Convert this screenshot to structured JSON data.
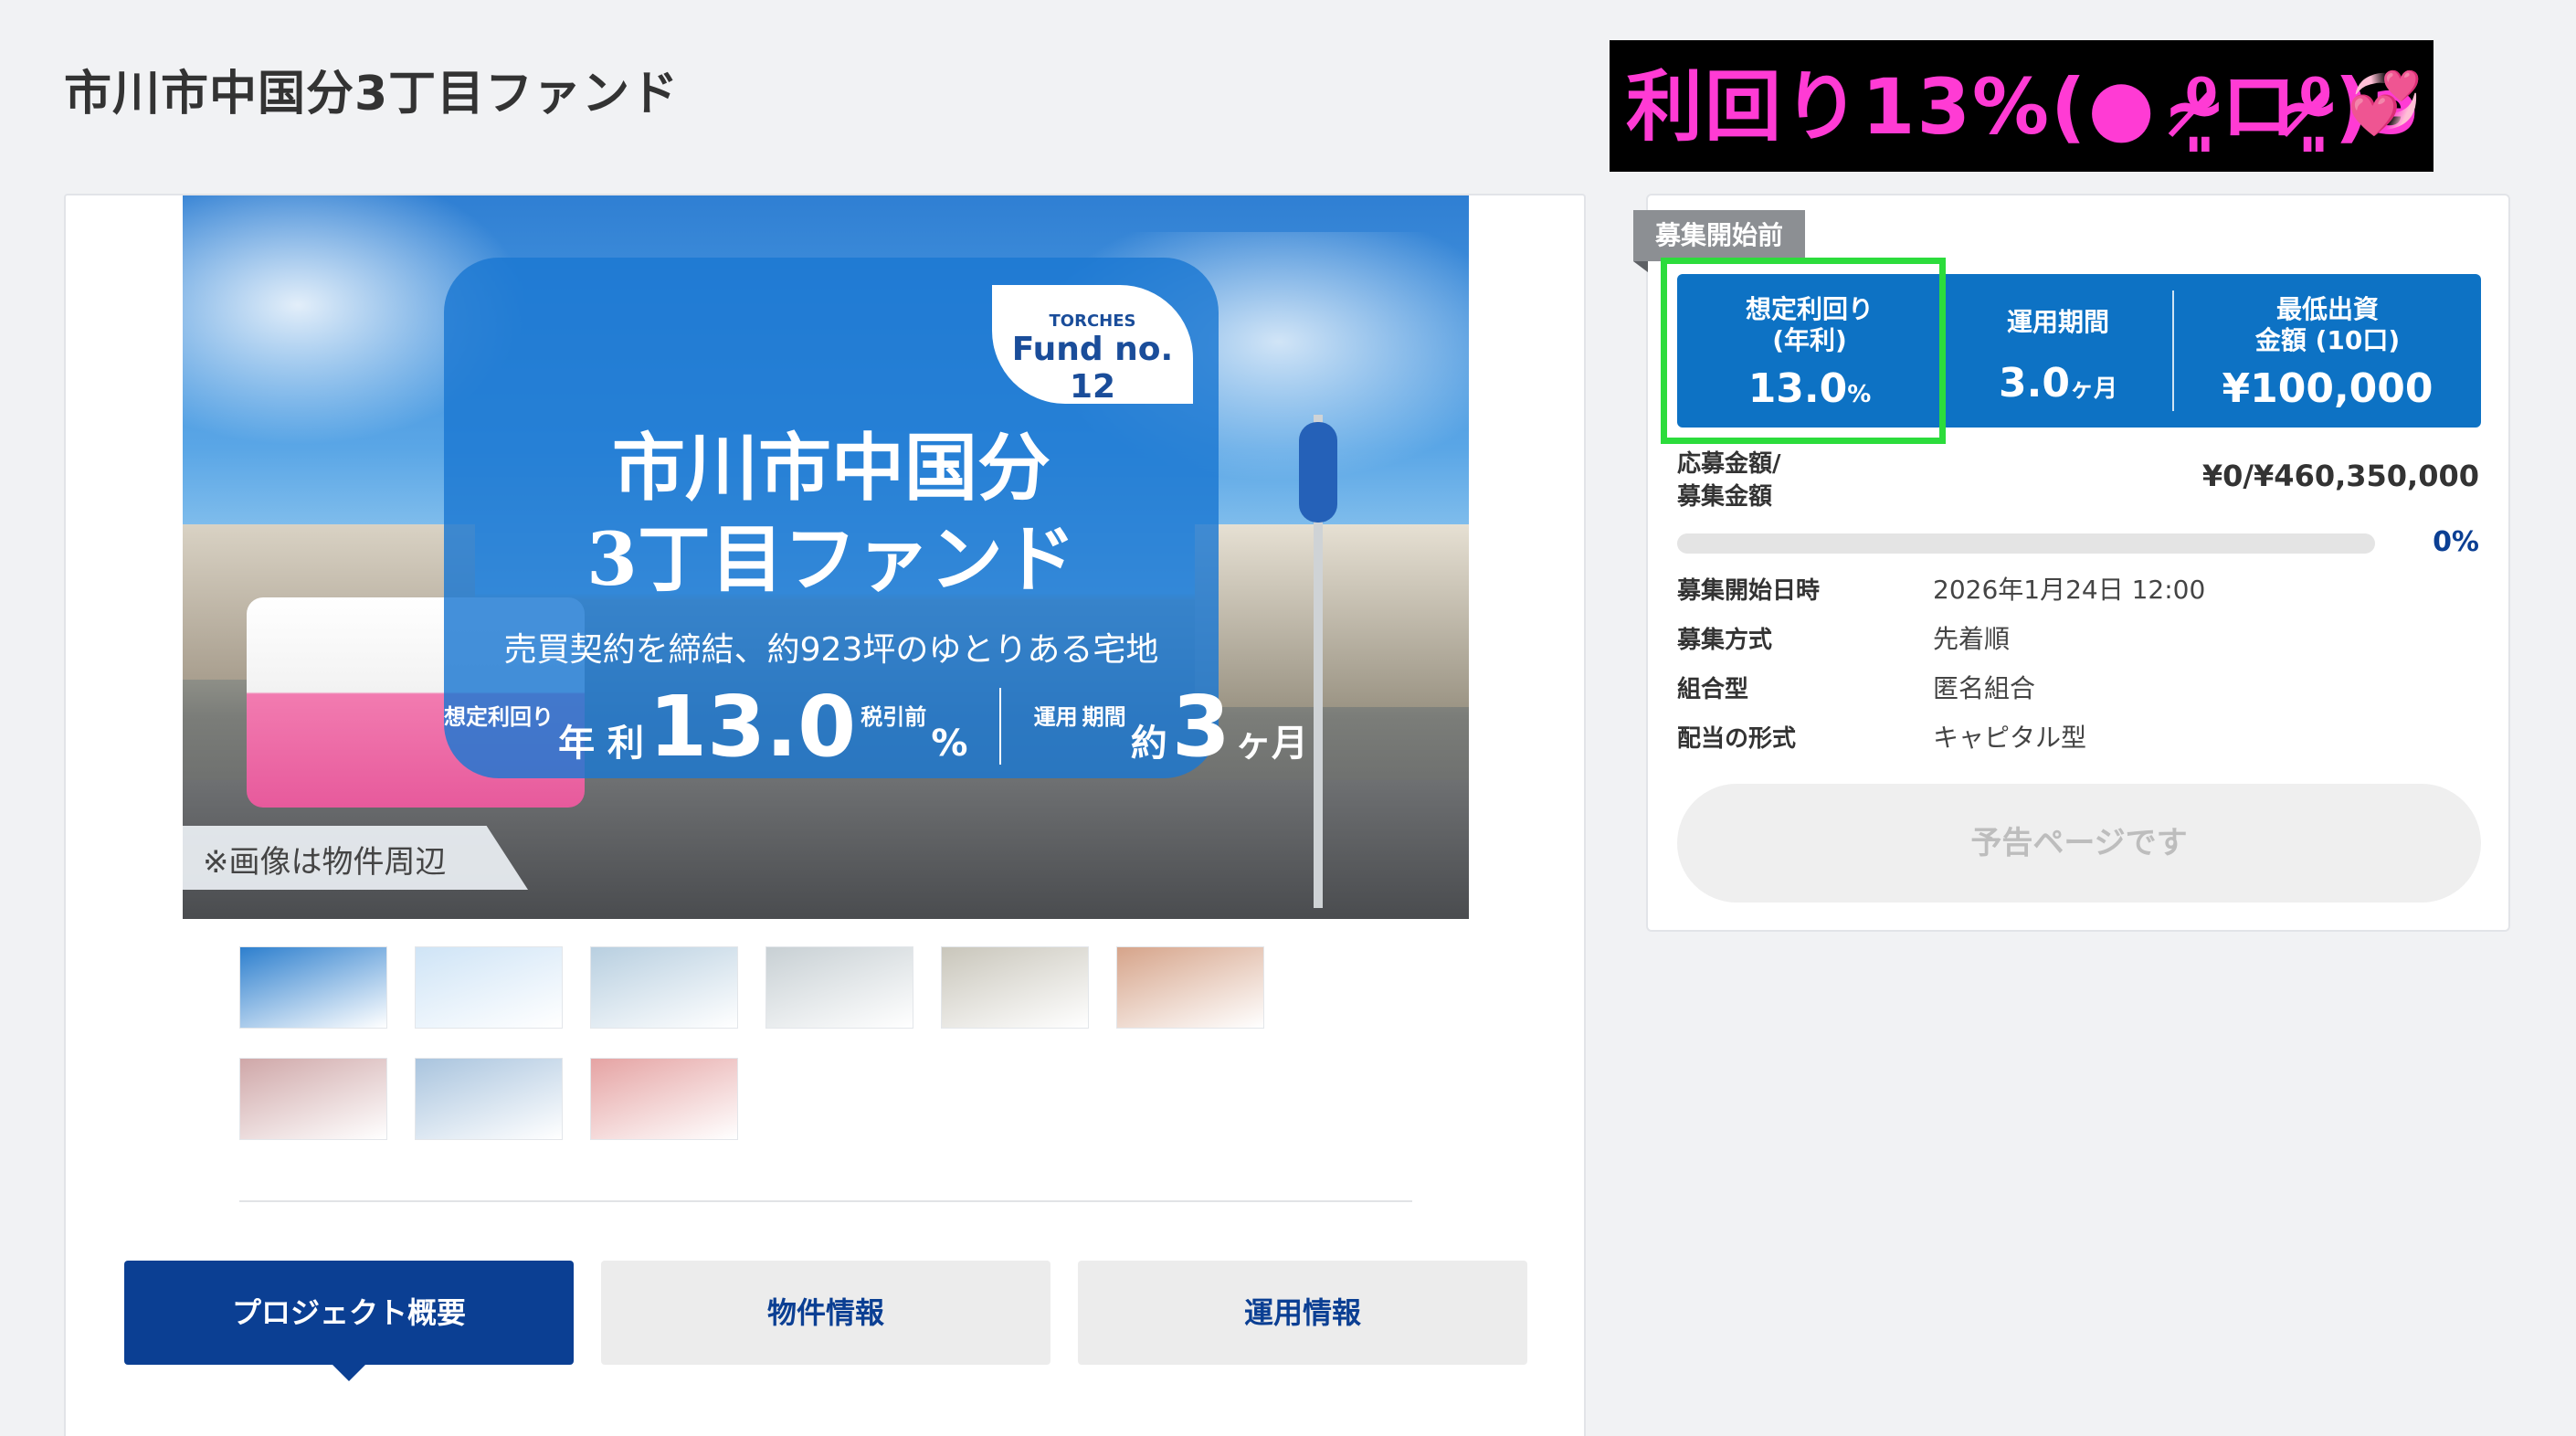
{
  "page": {
    "title": "市川市中国分3丁目ファンド"
  },
  "banner": {
    "text": "利回り13%(● ⁰̷̴͈ロ⁰̷̴͈)϶",
    "heart": "💞",
    "text_color": "#ff3bd4",
    "background": "#000000"
  },
  "hero": {
    "badge_line1": "TORCHES",
    "badge_line2": "Fund no. 12",
    "title_line1": "市川市中国分",
    "title_line2": "3丁目ファンド",
    "subtitle": "売買契約を締結、約923坪のゆとりある宅地",
    "yield_label_top": "想定利回り",
    "yield_label": "年 利",
    "yield_value": "13.0",
    "yield_unit": "%",
    "yield_note": "税引前",
    "term_label_top": "運用",
    "term_label_bottom": "期間",
    "term_prefix": "約",
    "term_value": "3",
    "term_unit": "ヶ月",
    "note": "※画像は物件周辺"
  },
  "thumbnails": [
    {
      "name": "hero-cover",
      "color": "#2d7fce"
    },
    {
      "name": "points-slide",
      "color": "#cfe4f6"
    },
    {
      "name": "station-tower",
      "color": "#b8cfe0"
    },
    {
      "name": "street-view",
      "color": "#c8d0d4"
    },
    {
      "name": "building-view",
      "color": "#c9c6bb"
    },
    {
      "name": "autumn-trees",
      "color": "#d6a48a"
    },
    {
      "name": "rose-garden",
      "color": "#cfa7a8"
    },
    {
      "name": "city-skyline",
      "color": "#a9c4de"
    },
    {
      "name": "campaign-banner",
      "color": "#e5a3a3"
    }
  ],
  "tabs": [
    {
      "label": "プロジェクト概要",
      "active": true
    },
    {
      "label": "物件情報",
      "active": false
    },
    {
      "label": "運用情報",
      "active": false
    }
  ],
  "side": {
    "status": "募集開始前",
    "stats": [
      {
        "label_line1": "想定利回り",
        "label_line2": "(年利)",
        "value": "13.0",
        "unit": "%"
      },
      {
        "label_line1": "運用期間",
        "label_line2": "",
        "value": "3.0",
        "unit": "ヶ月"
      },
      {
        "label_line1": "最低出資",
        "label_line2": "金額 (10口)",
        "value": "¥100,000",
        "unit": ""
      }
    ],
    "amount_label_line1": "応募金額/",
    "amount_label_line2": "募集金額",
    "amount_value": "¥0/¥460,350,000",
    "progress_percent": 0,
    "progress_label": "0%",
    "details": [
      {
        "key": "募集開始日時",
        "value": "2026年1月24日 12:00"
      },
      {
        "key": "募集方式",
        "value": "先着順"
      },
      {
        "key": "組合型",
        "value": "匿名組合"
      },
      {
        "key": "配当の形式",
        "value": "キャピタル型"
      }
    ],
    "cta_label": "予告ページです"
  },
  "colors": {
    "primary_navy": "#0b3f93",
    "stats_blue": "#0d72c4",
    "highlight_green": "#2cdc3c",
    "status_gray": "#8c8f93"
  }
}
